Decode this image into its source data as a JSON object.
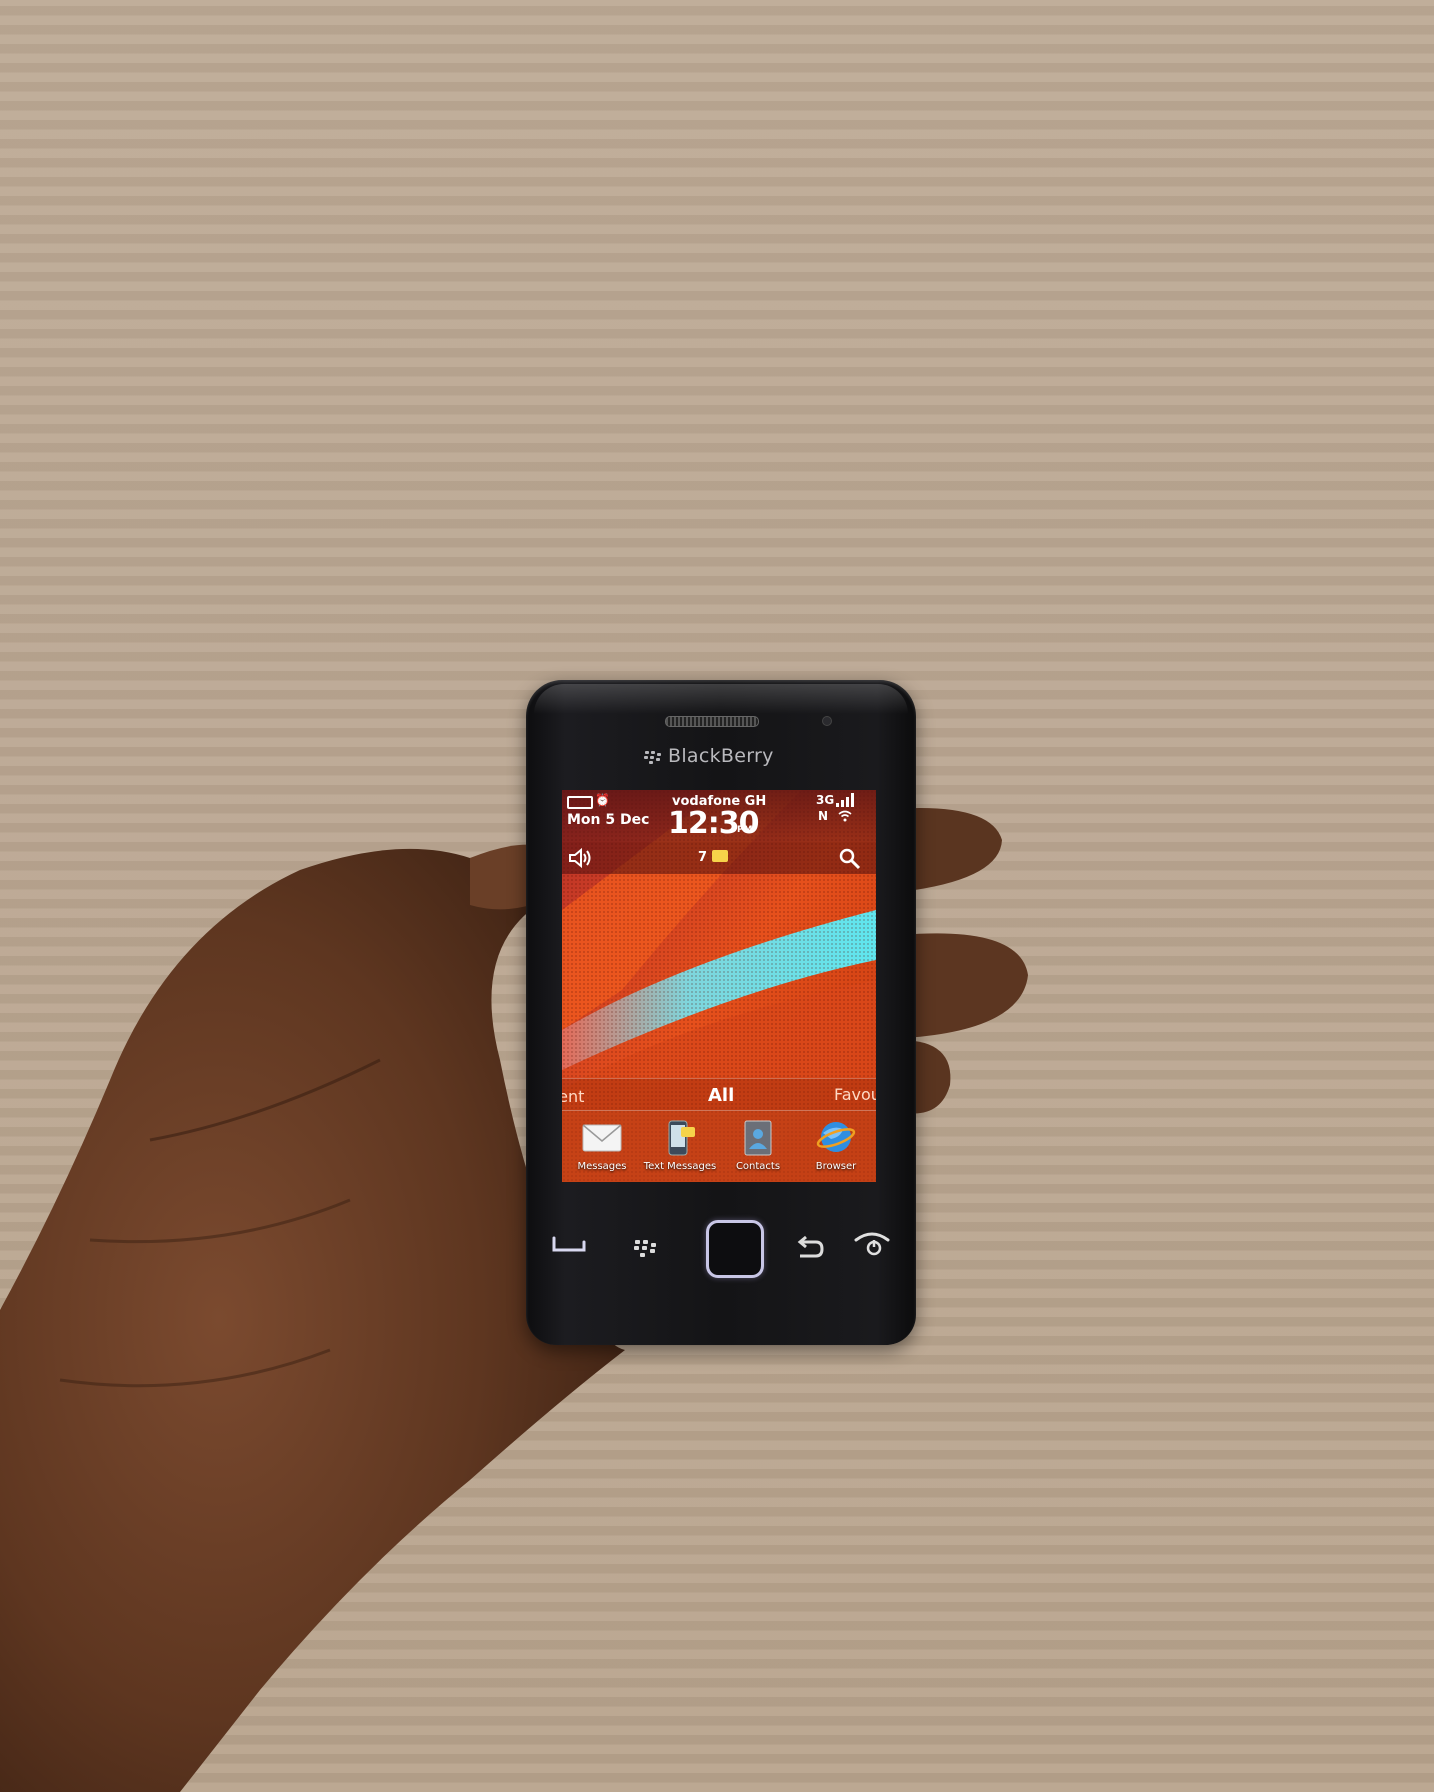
{
  "phone": {
    "brand": "BlackBerry",
    "status": {
      "date": "Mon 5 Dec",
      "carrier": "vodafone GH",
      "time": "12:30",
      "ampm": "PM",
      "network": "3G",
      "network_n": "N"
    },
    "toolbar": {
      "message_count": "7"
    },
    "tabs": {
      "frequent": "uent",
      "all": "All",
      "favorites": "Favou"
    },
    "dock": [
      {
        "label": "Messages",
        "icon": "envelope-icon"
      },
      {
        "label": "Text Messages",
        "icon": "text-messages-icon"
      },
      {
        "label": "Contacts",
        "icon": "contacts-icon"
      },
      {
        "label": "Browser",
        "icon": "globe-icon"
      }
    ],
    "keys": [
      "call-key-icon",
      "menu-key-icon",
      "trackpad",
      "back-key-icon",
      "end-call-key-icon"
    ]
  },
  "colors": {
    "background": "#bba792",
    "phone_body": "#141416",
    "screen_orange": "#e2481a",
    "screen_cyan": "#5fe0e8",
    "trackpad_ring": "#c8c6e6"
  }
}
